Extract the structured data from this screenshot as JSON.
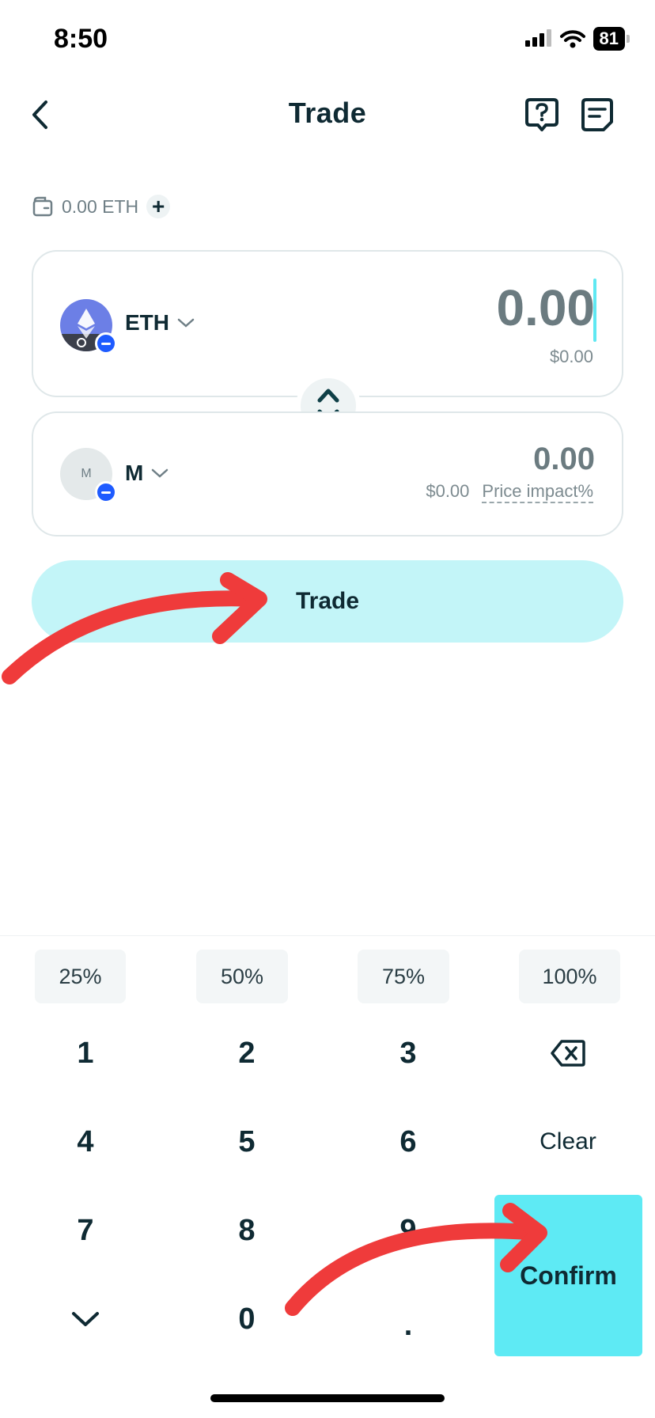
{
  "status_bar": {
    "time": "8:50",
    "battery": "81",
    "icons": [
      "cellular-signal-icon",
      "wifi-icon",
      "battery-icon"
    ]
  },
  "nav": {
    "title": "Trade",
    "icons": [
      "back-icon",
      "help-icon",
      "history-icon"
    ]
  },
  "balance": {
    "text": "0.00 ETH",
    "add_label": "+"
  },
  "from_token": {
    "symbol": "ETH",
    "amount": "0.00",
    "usd_value": "$0.00"
  },
  "to_token": {
    "symbol": "M",
    "icon_letter": "M",
    "amount": "0.00",
    "usd_value": "$0.00",
    "price_impact_label": "Price impact%"
  },
  "trade_button": {
    "label": "Trade"
  },
  "keypad": {
    "percent_buttons": [
      "25%",
      "50%",
      "75%",
      "100%"
    ],
    "keys": [
      "1",
      "2",
      "3",
      "4",
      "5",
      "6",
      "7",
      "8",
      "9",
      "0",
      "."
    ],
    "clear_label": "Clear",
    "confirm_label": "Confirm"
  },
  "colors": {
    "accent": "#5eeaf4",
    "trade_button_bg": "#c3f5f8",
    "annotation_arrow": "#ef3b3b",
    "text_primary": "#0f2a33",
    "text_muted": "#6f7f86"
  }
}
